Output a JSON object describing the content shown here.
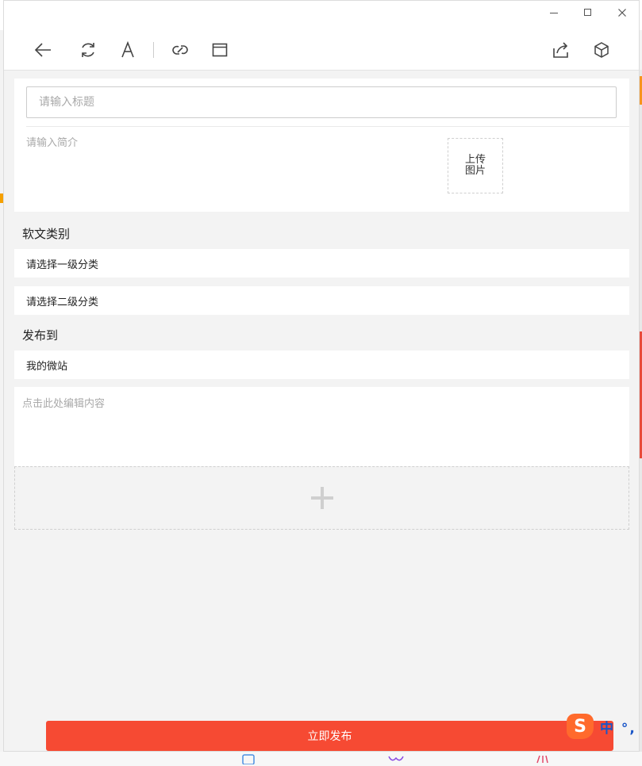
{
  "window": {
    "controls": {
      "minimize": "minimize",
      "maximize": "maximize",
      "close": "close"
    }
  },
  "toolbar": {
    "icons": [
      "back-arrow-icon",
      "refresh-icon",
      "font-icon",
      "link-icon",
      "window-icon",
      "share-icon",
      "cube-icon"
    ]
  },
  "form": {
    "title_placeholder": "请输入标题",
    "summary_placeholder": "请输入简介",
    "upload_label": "上传图片",
    "category_label": "软文类别",
    "category_level1": "请选择一级分类",
    "category_level2": "请选择二级分类",
    "publish_to_label": "发布到",
    "publish_target": "我的微站",
    "editor_placeholder": "点击此处编辑内容",
    "add_block_icon": "plus-icon"
  },
  "actions": {
    "publish_label": "立即发布"
  },
  "ime": {
    "logo": "S",
    "status": "中 °,"
  },
  "colors": {
    "publish_button": "#f64a33",
    "background": "#f3f3f3",
    "ime_logo": "#ff6a2c",
    "ime_text": "#1a56c8"
  }
}
